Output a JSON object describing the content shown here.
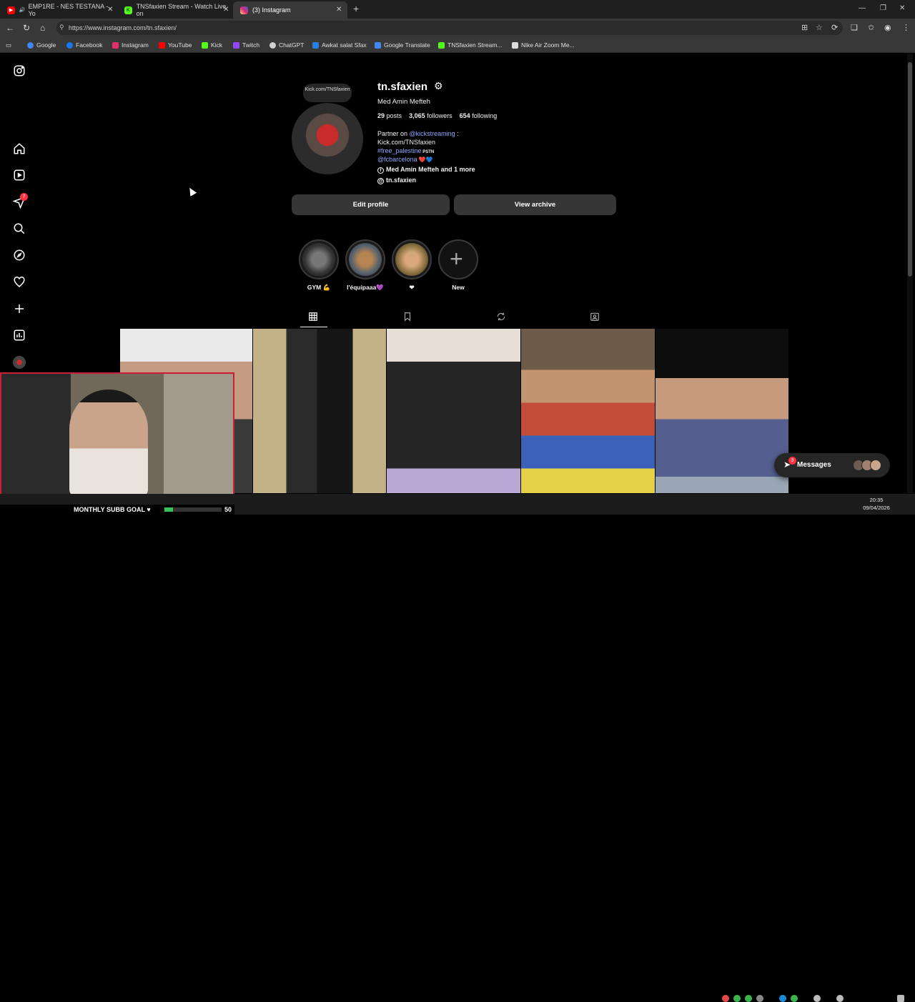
{
  "browser": {
    "tabs": [
      {
        "label": "EMP1RE - NES TESTANA - Yo",
        "icon": "youtube-icon",
        "color": "#ff0000"
      },
      {
        "label": "TNSfaxien Stream - Watch Live on",
        "icon": "kick-icon",
        "color": "#53fc18"
      },
      {
        "label": "(3) Instagram",
        "icon": "instagram-icon",
        "color": "#e1306c"
      }
    ],
    "url": "https://www.instagram.com/tn.sfaxien/",
    "bookmarks": [
      {
        "label": "Google",
        "color": "#4285f4"
      },
      {
        "label": "Facebook",
        "color": "#1877f2"
      },
      {
        "label": "Instagram",
        "color": "#e1306c"
      },
      {
        "label": "YouTube",
        "color": "#ff0000"
      },
      {
        "label": "Kick",
        "color": "#53fc18"
      },
      {
        "label": "Twitch",
        "color": "#9146ff"
      },
      {
        "label": "ChatGPT",
        "color": "#d0d0d0"
      },
      {
        "label": "Awkat salat Sfax",
        "color": "#2a7de1"
      },
      {
        "label": "Google Translate",
        "color": "#4285f4"
      },
      {
        "label": "TNSfaxien Stream...",
        "color": "#53fc18"
      },
      {
        "label": "Nike Air Zoom Me...",
        "color": "#dddddd"
      }
    ]
  },
  "sidebar": {
    "notification_count": "7"
  },
  "profile": {
    "username": "tn.sfaxien",
    "full_name": "Med Amin Mefteh",
    "note": "Kick.com/TNSfaxien",
    "posts_count": "29",
    "posts_label": "posts",
    "followers_count": "3,065",
    "followers_label": "followers",
    "following_count": "654",
    "following_label": "following",
    "bio_line1_prefix": "Partner on ",
    "bio_line1_link": "@kickstreaming",
    "bio_line1_suffix": " :",
    "bio_line2": "Kick.com/TNSfaxien",
    "bio_line3_link": "#free_palestine",
    "bio_line3_suffix": " PSTN",
    "bio_line4_link": "@fcbarcelona",
    "bio_line4_suffix": " ❤️💙",
    "bio_facebook": "Med Amin Mefteh and 1 more",
    "bio_threads": "tn.sfaxien",
    "edit_profile_label": "Edit profile",
    "view_archive_label": "View archive"
  },
  "highlights": [
    {
      "label": "GYM 💪"
    },
    {
      "label": "l'équipaaa💜"
    },
    {
      "label": "❤"
    },
    {
      "label": "New"
    }
  ],
  "messages": {
    "label": "Messages",
    "badge": "3"
  },
  "stream_overlay": {
    "goal_label": "MONTHLY SUBB GOAL ♥",
    "goal_value": "50",
    "goal_progress": 0.15
  },
  "taskbar": {
    "time": "20:35",
    "date": "09/04/2026"
  },
  "colors": {
    "accent_link": "#8ea6ff",
    "notification_red": "#ff3040",
    "button_bg": "#363636"
  }
}
